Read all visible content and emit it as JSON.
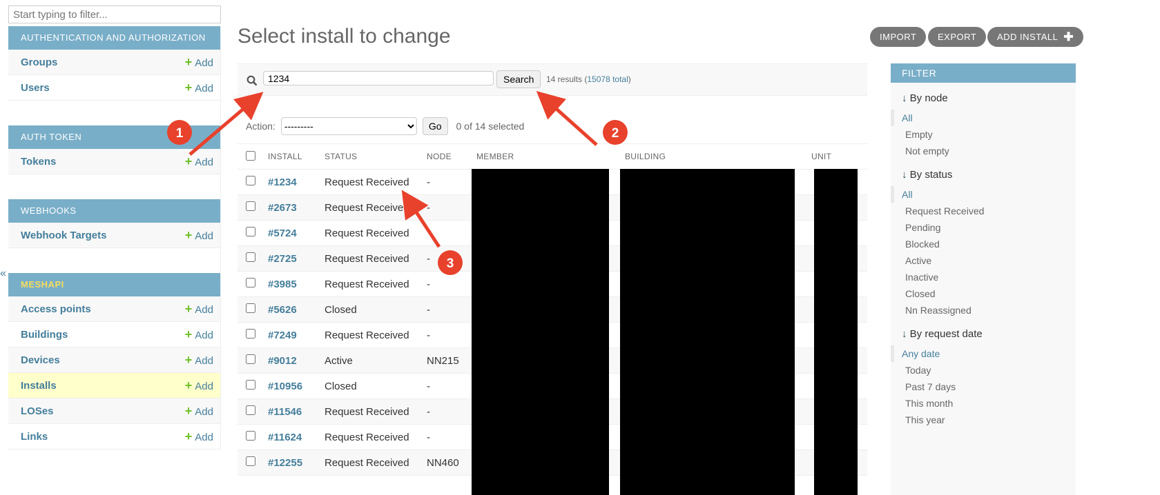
{
  "sidebar": {
    "filter_placeholder": "Start typing to filter...",
    "add_label": "Add",
    "modules": [
      {
        "title": "Authentication and Authorization",
        "items": [
          "Groups",
          "Users"
        ]
      },
      {
        "title": "Auth Token",
        "items": [
          "Tokens"
        ]
      },
      {
        "title": "Webhooks",
        "items": [
          "Webhook Targets"
        ]
      },
      {
        "title": "Meshapi",
        "current": true,
        "items": [
          "Access points",
          "Buildings",
          "Devices",
          "Installs",
          "LOSes",
          "Links"
        ],
        "selected": "Installs"
      }
    ],
    "collapse_glyph": "«"
  },
  "header": {
    "title": "Select install to change",
    "buttons": [
      "IMPORT",
      "EXPORT",
      "ADD INSTALL"
    ]
  },
  "search": {
    "value": "1234",
    "button": "Search",
    "results": "14 results",
    "total": "15078 total"
  },
  "actions": {
    "label": "Action:",
    "selected": "---------",
    "go": "Go",
    "selected_count": "0 of 14 selected"
  },
  "table": {
    "columns": [
      "INSTALL",
      "STATUS",
      "NODE",
      "MEMBER",
      "BUILDING",
      "UNIT"
    ],
    "rows": [
      [
        "#1234",
        "Request Received",
        "-"
      ],
      [
        "#2673",
        "Request Received",
        "-"
      ],
      [
        "#5724",
        "Request Received",
        ""
      ],
      [
        "#2725",
        "Request Received",
        "-"
      ],
      [
        "#3985",
        "Request Received",
        "-"
      ],
      [
        "#5626",
        "Closed",
        "-"
      ],
      [
        "#7249",
        "Request Received",
        "-"
      ],
      [
        "#9012",
        "Active",
        "NN215"
      ],
      [
        "#10956",
        "Closed",
        "-"
      ],
      [
        "#11546",
        "Request Received",
        "-"
      ],
      [
        "#11624",
        "Request Received",
        "-"
      ],
      [
        "#12255",
        "Request Received",
        "NN460"
      ]
    ]
  },
  "filter": {
    "title": "FILTER",
    "groups": [
      {
        "title": "By node",
        "options": [
          "All",
          "Empty",
          "Not empty"
        ]
      },
      {
        "title": "By status",
        "options": [
          "All",
          "Request Received",
          "Pending",
          "Blocked",
          "Active",
          "Inactive",
          "Closed",
          "Nn Reassigned"
        ]
      },
      {
        "title": "By request date",
        "options": [
          "Any date",
          "Today",
          "Past 7 days",
          "This month",
          "This year"
        ]
      }
    ]
  },
  "annotations": [
    "1",
    "2",
    "3"
  ],
  "colors": {
    "module_header": "#79aec8",
    "link": "#447e9b",
    "annotation": "#e8412c",
    "selected_row": "#ffffcc",
    "add_plus": "#70bf2b"
  }
}
